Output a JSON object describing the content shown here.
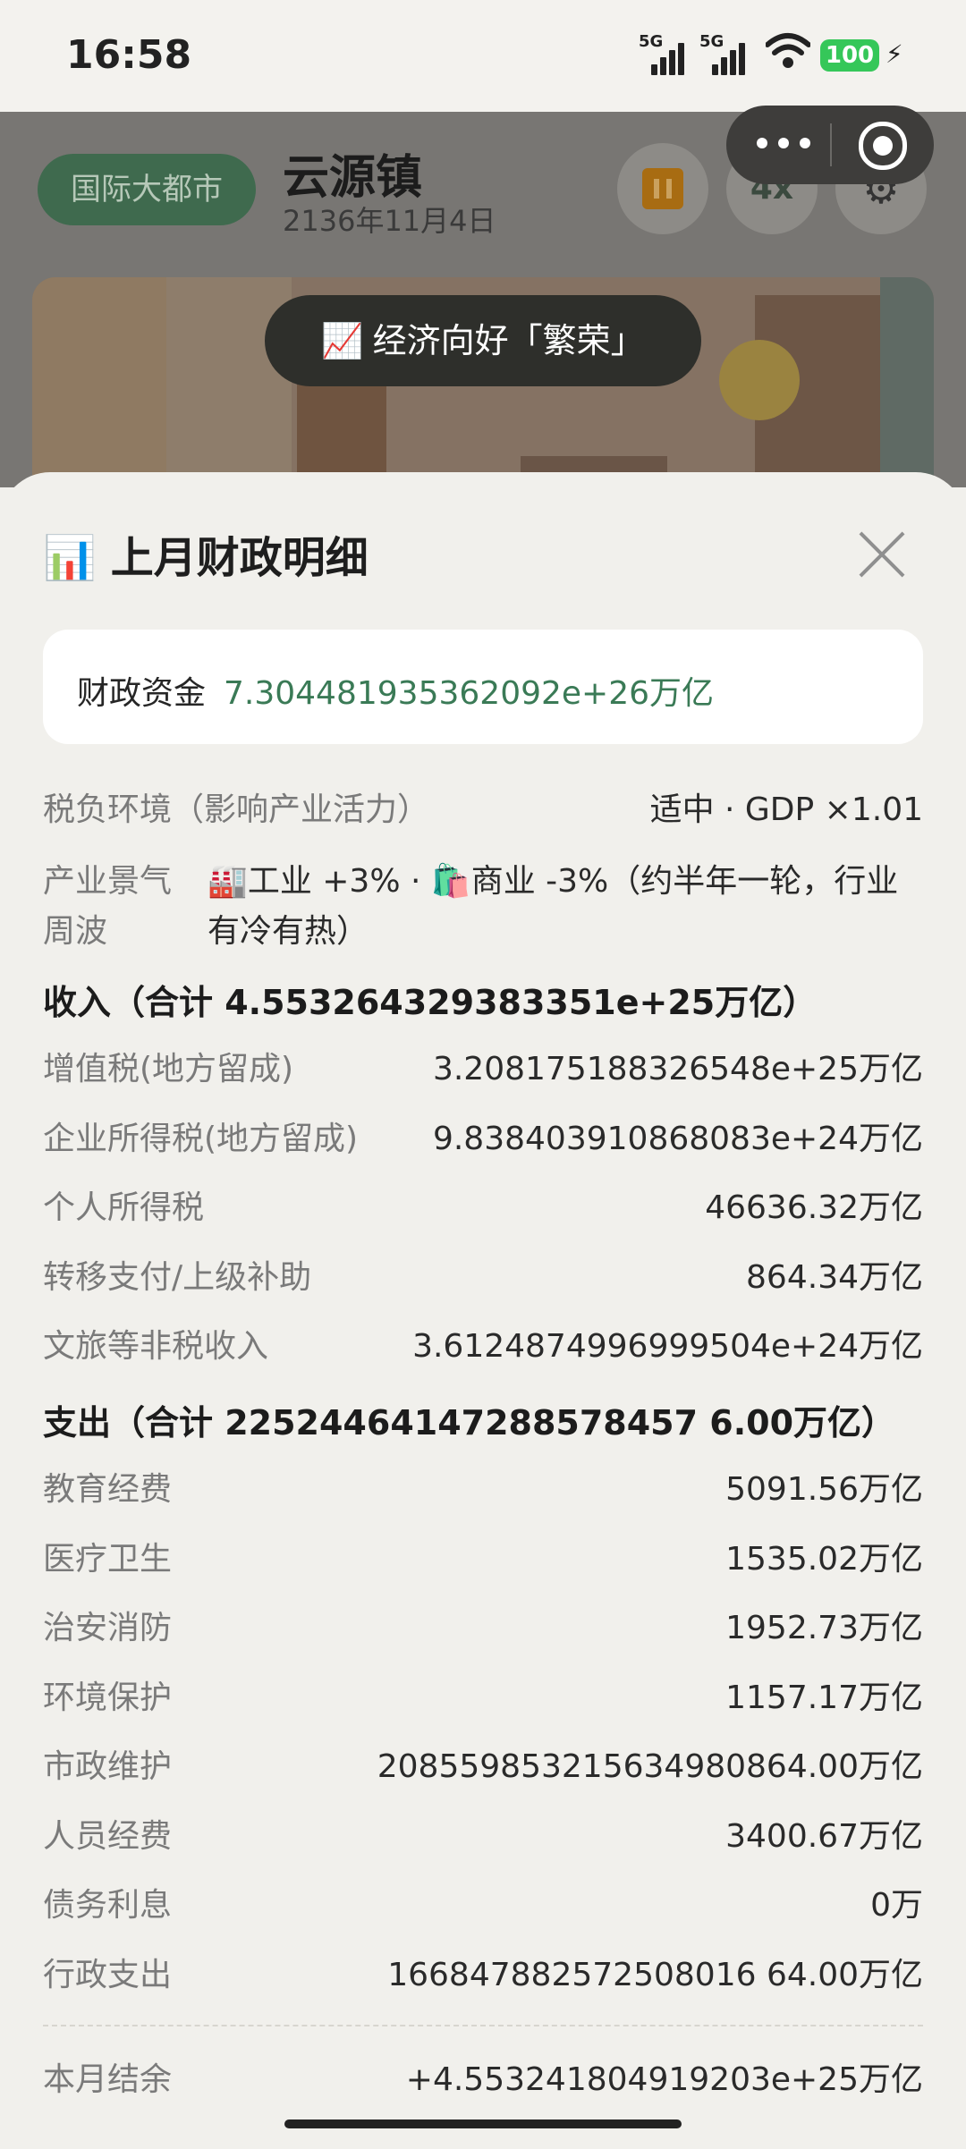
{
  "status_bar": {
    "time": "16:58",
    "signal1_label": "5G",
    "signal2_label": "5G",
    "battery": "100",
    "icons": [
      "signal-icon",
      "signal-icon",
      "wifi-icon",
      "battery-icon",
      "charging-icon"
    ]
  },
  "header": {
    "badge": "国际大都市",
    "town_name": "云源镇",
    "date": "2136年11月4日",
    "speed": "4x",
    "icons": [
      "pause-icon",
      "gear-icon",
      "more-icon",
      "target-icon"
    ]
  },
  "toast": {
    "icon": "📈",
    "text": "经济向好「繁荣」"
  },
  "sheet": {
    "title_icon": "📊",
    "title": "上月财政明细",
    "fund_label": "财政资金",
    "fund_value": "7.304481935362092e+26万亿",
    "tax_env_label": "税负环境（影响产业活力）",
    "tax_env_value": "适中 · GDP ×1.01",
    "cycle_label": "产业景气周波",
    "cycle_value": "🏭工业 +3% · 🛍️商业 -3%（约半年一轮，行业有冷有热）",
    "income_header": "收入（合计 4.553264329383351e+25万亿）",
    "income": [
      {
        "label": "增值税(地方留成)",
        "value": "3.208175188326548e+25万亿"
      },
      {
        "label": "企业所得税(地方留成)",
        "value": "9.838403910868083e+24万亿"
      },
      {
        "label": "个人所得税",
        "value": "46636.32万亿"
      },
      {
        "label": "转移支付/上级补助",
        "value": "864.34万亿"
      },
      {
        "label": "文旅等非税收入",
        "value": "3.6124874996999504e+24万亿"
      }
    ],
    "expense_header": "支出（合计 22524464147288578457 6.00万亿）",
    "expense": [
      {
        "label": "教育经费",
        "value": "5091.56万亿"
      },
      {
        "label": "医疗卫生",
        "value": "1535.02万亿"
      },
      {
        "label": "治安消防",
        "value": "1952.73万亿"
      },
      {
        "label": "环境保护",
        "value": "1157.17万亿"
      },
      {
        "label": "市政维护",
        "value": "208559853215634980864.00万亿"
      },
      {
        "label": "人员经费",
        "value": "3400.67万亿"
      },
      {
        "label": "债务利息",
        "value": "0万"
      },
      {
        "label": "行政支出",
        "value": "166847882572508016 64.00万亿"
      }
    ],
    "balance_label": "本月结余",
    "balance_value": "+4.553241804919203e+25万亿"
  }
}
